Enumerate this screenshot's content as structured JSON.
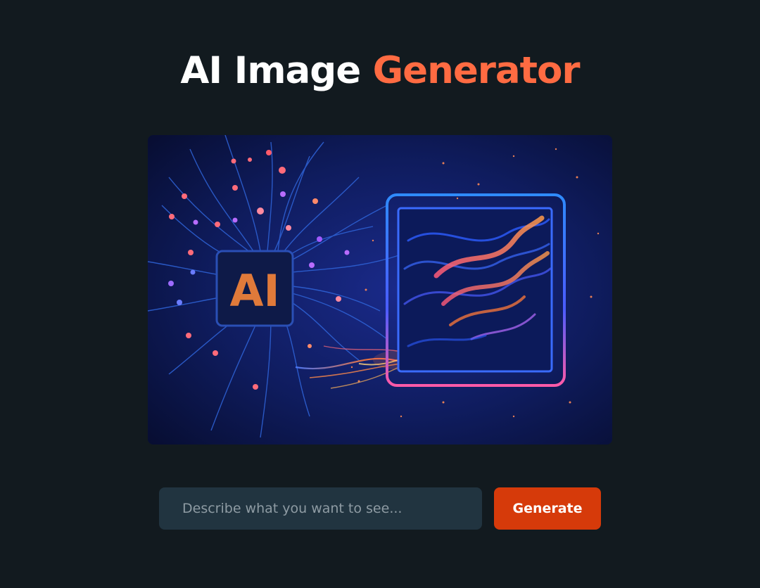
{
  "header": {
    "title_part1": "AI Image",
    "title_part2": "Generator"
  },
  "hero": {
    "chip_label": "AI"
  },
  "prompt": {
    "placeholder": "Describe what you want to see...",
    "value": "",
    "button_label": "Generate"
  },
  "colors": {
    "background": "#121a1f",
    "accent": "#ff6b42",
    "button": "#d63a0a",
    "input_bg": "#213440"
  }
}
